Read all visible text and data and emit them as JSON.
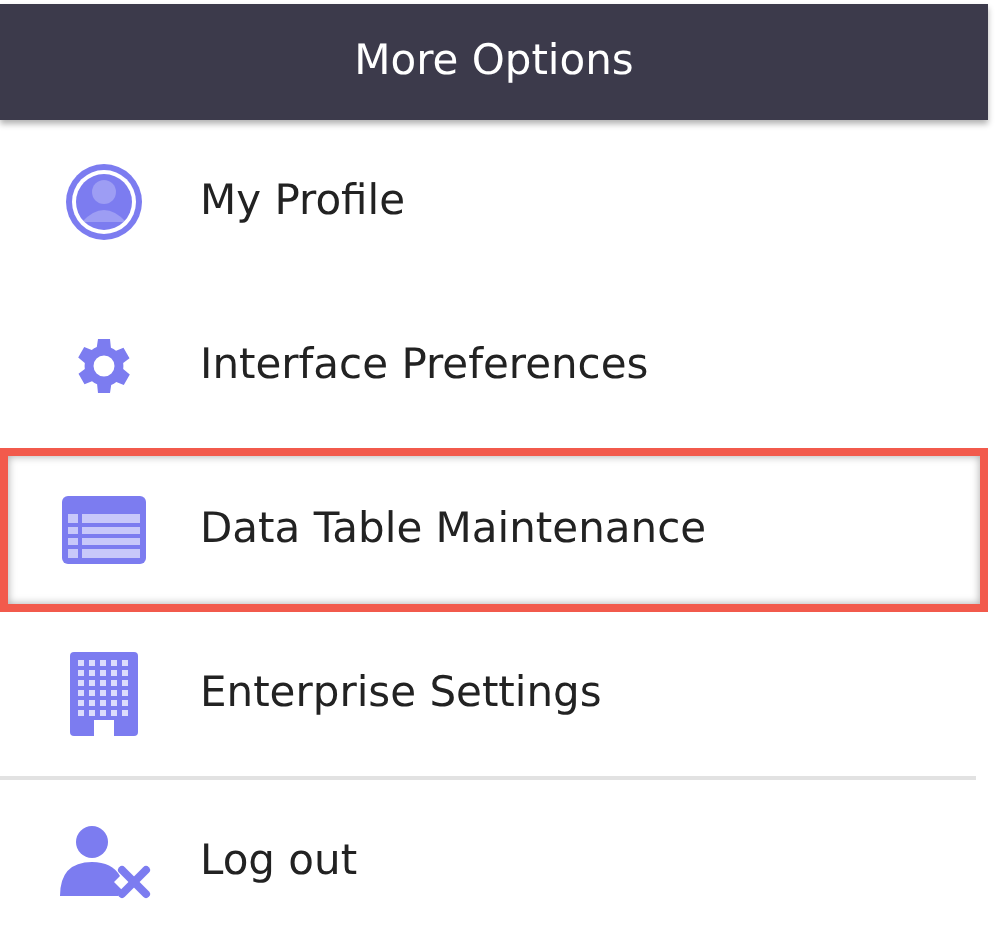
{
  "menu": {
    "title": "More Options",
    "sections": [
      {
        "items": [
          {
            "kind": "profile",
            "label": "My Profile",
            "highlighted": false
          },
          {
            "kind": "gear",
            "label": "Interface Preferences",
            "highlighted": false
          },
          {
            "kind": "table",
            "label": "Data Table Maintenance",
            "highlighted": true
          },
          {
            "kind": "building",
            "label": "Enterprise Settings",
            "highlighted": false
          }
        ]
      },
      {
        "items": [
          {
            "kind": "logout",
            "label": "Log out",
            "highlighted": false
          }
        ]
      }
    ]
  }
}
